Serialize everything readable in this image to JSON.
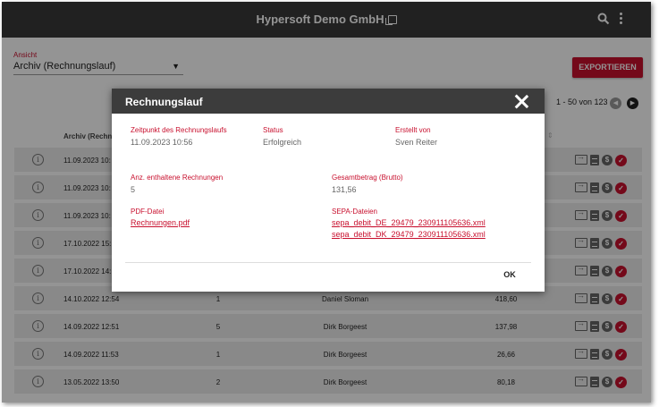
{
  "app": {
    "title": "Hypersoft Demo GmbH"
  },
  "icons": {
    "search": "search-icon",
    "more": "more-vertical-icon",
    "window": "window-icon",
    "close": "close-icon"
  },
  "view": {
    "label": "Ansicht",
    "selected": "Archiv (Rechnungslauf)"
  },
  "export_label": "EXPORTIEREN",
  "pager": {
    "text": "1 - 50 von 123"
  },
  "table": {
    "headers": {
      "archive": "Archiv (Rechnu"
    },
    "rows": [
      {
        "date": "11.09.2023 10:",
        "count": "",
        "user": "",
        "amount": ""
      },
      {
        "date": "11.09.2023 10:",
        "count": "",
        "user": "",
        "amount": ""
      },
      {
        "date": "11.09.2023 10:",
        "count": "",
        "user": "",
        "amount": ""
      },
      {
        "date": "17.10.2022 15:",
        "count": "",
        "user": "",
        "amount": ""
      },
      {
        "date": "17.10.2022 14:",
        "count": "",
        "user": "",
        "amount": ""
      },
      {
        "date": "14.10.2022 12:54",
        "count": "1",
        "user": "Daniel Sloman",
        "amount": "418,60"
      },
      {
        "date": "14.09.2022 12:51",
        "count": "5",
        "user": "Dirk Borgeest",
        "amount": "137,98"
      },
      {
        "date": "14.09.2022 11:53",
        "count": "1",
        "user": "Dirk Borgeest",
        "amount": "26,66"
      },
      {
        "date": "13.05.2022 13:50",
        "count": "2",
        "user": "Dirk Borgeest",
        "amount": "80,18"
      }
    ]
  },
  "dialog": {
    "title": "Rechnungslauf",
    "time_label": "Zeitpunkt des Rechnungslaufs",
    "time_value": "11.09.2023 10:56",
    "status_label": "Status",
    "status_value": "Erfolgreich",
    "creator_label": "Erstellt von",
    "creator_value": "Sven Reiter",
    "count_label": "Anz. enthaltene Rechnungen",
    "count_value": "5",
    "total_label": "Gesamtbetrag (Brutto)",
    "total_value": "131,56",
    "pdf_label": "PDF-Datei",
    "pdf_file": "Rechnungen.pdf",
    "sepa_label": "SEPA-Dateien",
    "sepa_files": [
      "sepa_debit_DE_29479_230911105636.xml",
      "sepa_debit_DK_29479_230911105636.xml"
    ],
    "ok_label": "OK"
  }
}
